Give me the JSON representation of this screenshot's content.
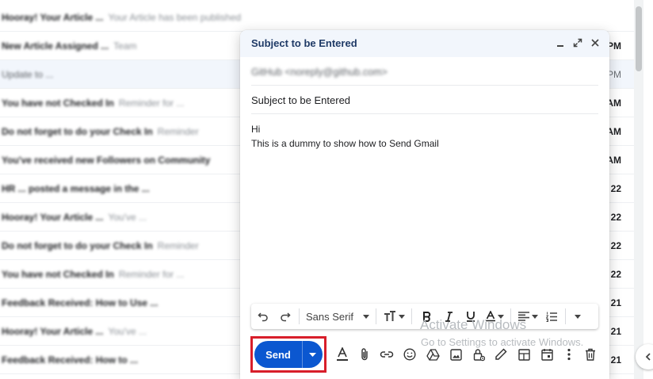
{
  "inbox": {
    "rows": [
      {
        "sender": "Hooray! Your Article ...",
        "snippet": "Your Article has been published",
        "time": "",
        "faded": true
      },
      {
        "sender": "New Article Assigned ...",
        "snippet": "Team",
        "time": "PM",
        "faded": false
      },
      {
        "sender": "Update to ...",
        "snippet": "",
        "time": "PM",
        "faded": true
      },
      {
        "sender": "You have not Checked In",
        "snippet": "Reminder for ...",
        "time": "AM",
        "faded": false
      },
      {
        "sender": "Do not forget to do your Check In",
        "snippet": "Reminder",
        "time": "AM",
        "faded": false
      },
      {
        "sender": "You've received new Followers on Community",
        "snippet": "",
        "time": "AM",
        "faded": false
      },
      {
        "sender": "HR ... posted a message in the ...",
        "snippet": "",
        "time": "22",
        "faded": false
      },
      {
        "sender": "Hooray! Your Article ...",
        "snippet": "You've ...",
        "time": "22",
        "faded": false
      },
      {
        "sender": "Do not forget to do your Check In",
        "snippet": "Reminder",
        "time": "22",
        "faded": false
      },
      {
        "sender": "You have not Checked In",
        "snippet": "Reminder for ...",
        "time": "22",
        "faded": false
      },
      {
        "sender": "Feedback Received: How to Use ...",
        "snippet": "",
        "time": "21",
        "faded": false
      },
      {
        "sender": "Hooray! Your Article ...",
        "snippet": "You've ...",
        "time": "21",
        "faded": false
      },
      {
        "sender": "Feedback Received: How to ...",
        "snippet": "",
        "time": "21",
        "faded": false
      }
    ]
  },
  "compose": {
    "title": "Subject to be Entered",
    "to_value": "GitHub <noreply@github.com>",
    "subject_value": "Subject to be Entered",
    "body_line_1": "Hi",
    "body_line_2": "This is a dummy to show how to Send Gmail",
    "font_name": "Sans Serif",
    "send_label": "Send"
  },
  "watermark": {
    "line1": "Activate Windows",
    "line2": "Go to Settings to activate Windows."
  },
  "colors": {
    "send_button": "#0b57d0",
    "highlight_box": "#d81e2a",
    "header_bg": "#f2f6fc"
  }
}
